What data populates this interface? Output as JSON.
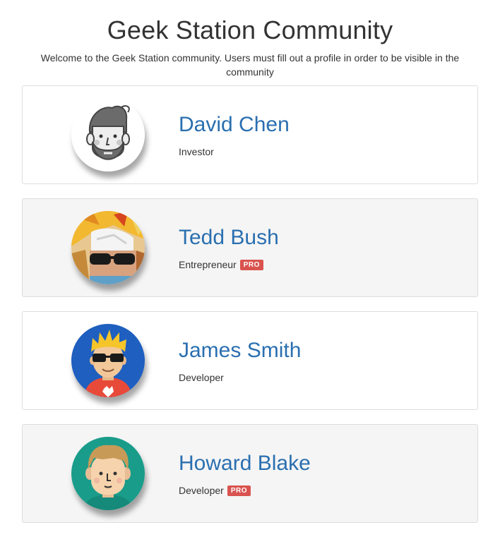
{
  "page": {
    "title": "Geek Station Community",
    "description": "Welcome to the Geek Station community. Users must fill out a profile in order to be visible in the community"
  },
  "members": [
    {
      "name": "David Chen",
      "role": "Investor",
      "pro": false,
      "avatar_icon": "bearded-man-sketch-icon"
    },
    {
      "name": "Tedd Bush",
      "role": "Entrepreneur",
      "pro": true,
      "pro_label": "PRO",
      "avatar_icon": "costume-photo-icon"
    },
    {
      "name": "James Smith",
      "role": "Developer",
      "pro": false,
      "avatar_icon": "sunglasses-man-icon"
    },
    {
      "name": "Howard Blake",
      "role": "Developer",
      "pro": true,
      "pro_label": "PRO",
      "avatar_icon": "smiling-man-icon"
    }
  ],
  "colors": {
    "name_link": "#2a6fb0",
    "pro_badge": "#d9534f",
    "card_border": "#dddddd",
    "card_alt_bg": "#f5f5f5"
  }
}
